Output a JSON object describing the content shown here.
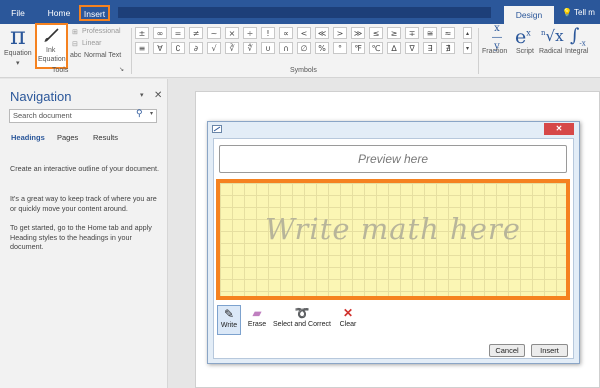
{
  "ribbon_tabs": {
    "file": "File",
    "home": "Home",
    "insert": "Insert",
    "design": "Design",
    "tell_me": "Tell m"
  },
  "tools_group": {
    "equation_label": "Equation",
    "ink_equation_line1": "Ink",
    "ink_equation_line2": "Equation",
    "professional": "Professional",
    "linear": "Linear",
    "normal_text": "Normal Text",
    "group_label": "Tools"
  },
  "symbols_group": {
    "row1": [
      "±",
      "∞",
      "=",
      "≠",
      "~",
      "×",
      "÷",
      "!",
      "∝",
      "<",
      "≪",
      ">",
      "≫",
      "≤",
      "≥",
      "∓",
      "≅",
      "≈"
    ],
    "row2": [
      "≡",
      "∀",
      "∁",
      "∂",
      "√",
      "∛",
      "∜",
      "∪",
      "∩",
      "∅",
      "%",
      "°",
      "℉",
      "℃",
      "∆",
      "∇",
      "∃",
      "∄"
    ],
    "group_label": "Symbols"
  },
  "structures": {
    "fraction": "Fraction",
    "script": "Script",
    "radical": "Radical",
    "integral": "Integral"
  },
  "navigation": {
    "title": "Navigation",
    "search_placeholder": "Search document",
    "tabs": {
      "headings": "Headings",
      "pages": "Pages",
      "results": "Results"
    },
    "para1": "Create an interactive outline of your document.",
    "para2": "It's a great way to keep track of where you are or quickly move your content around.",
    "para3": "To get started, go to the Home tab and apply Heading styles to the headings in your document."
  },
  "dialog": {
    "preview_text": "Preview here",
    "write_text": "Write math here",
    "tools": {
      "write": "Write",
      "erase": "Erase",
      "select_correct": "Select and Correct",
      "clear": "Clear"
    },
    "cancel": "Cancel",
    "insert": "Insert"
  },
  "colors": {
    "accent_blue": "#2b579a",
    "highlight_orange": "#f58220",
    "ink_area": "#fbf6b4"
  }
}
